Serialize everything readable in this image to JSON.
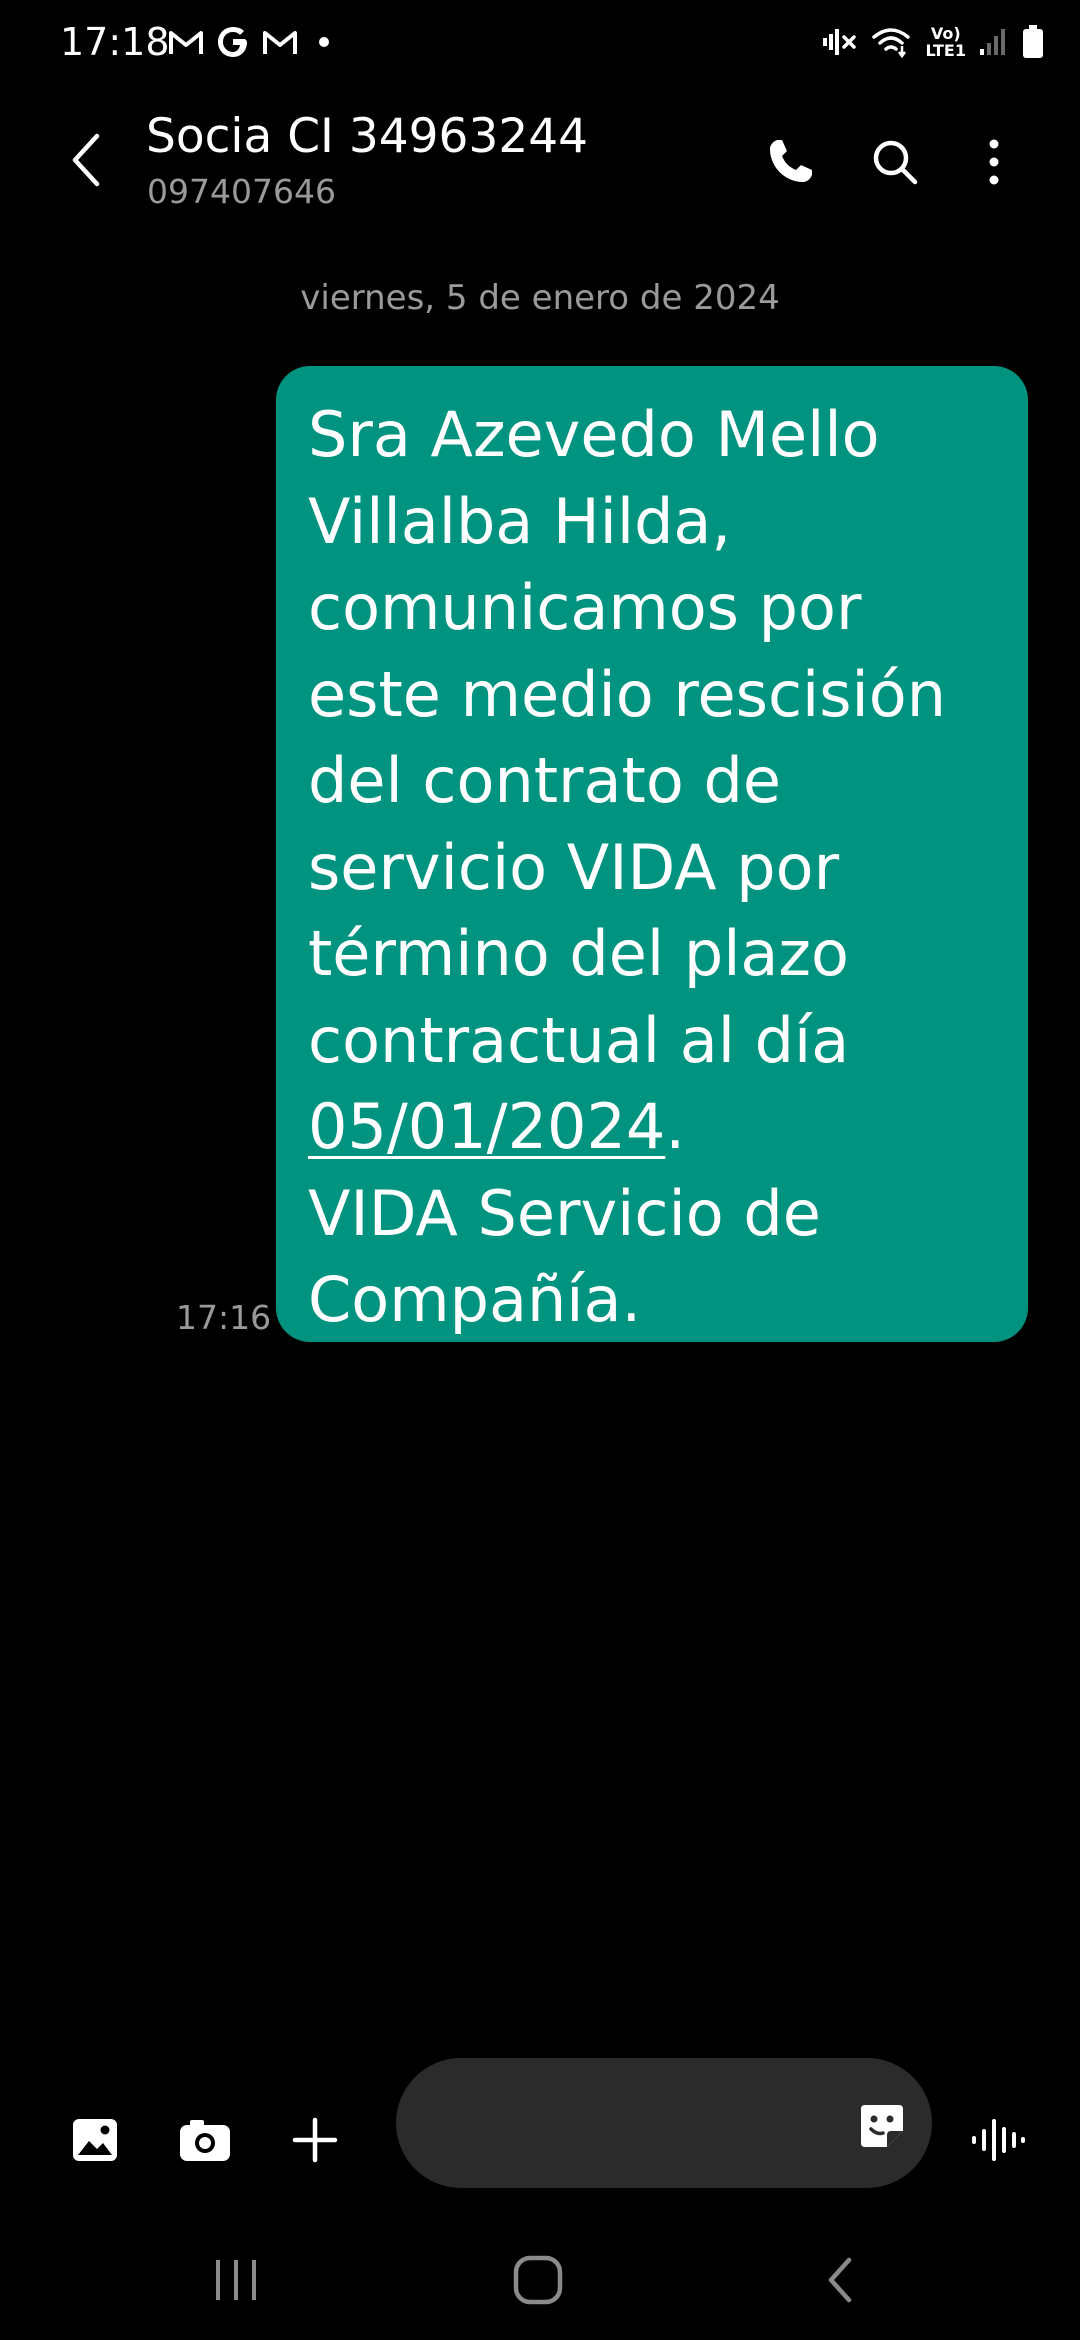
{
  "status_bar": {
    "time": "17:18",
    "notifications": [
      "gmail-icon",
      "google-icon",
      "gmail-icon",
      "dot-icon"
    ],
    "network_label_top": "Vo)",
    "network_label_bottom": "LTE1"
  },
  "header": {
    "contact_name": "Socia CI 34963244",
    "contact_number": "097407646"
  },
  "conversation": {
    "date_separator": "viernes, 5 de enero de 2024",
    "messages": [
      {
        "time": "17:16",
        "lines": [
          "Sra Azevedo Mello",
          "Villalba Hilda,",
          "comunicamos por",
          "este medio rescisión",
          "del contrato de",
          "servicio VIDA por",
          "término del plazo",
          "contractual al día"
        ],
        "date_link": "05/01/2024",
        "date_suffix": ".",
        "closing_lines": [
          "VIDA Servicio de",
          "Compañía."
        ]
      }
    ]
  },
  "composer": {
    "placeholder": ""
  },
  "colors": {
    "background": "#000000",
    "bubble": "#00937f",
    "secondary_text": "#9a9a9a",
    "input_pill": "#2b2b2b"
  }
}
